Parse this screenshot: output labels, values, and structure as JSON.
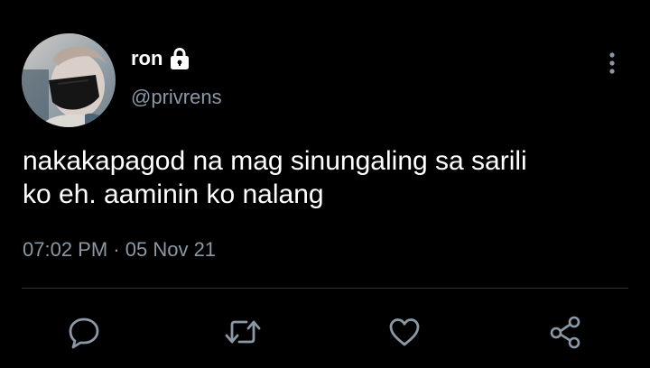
{
  "user": {
    "display_name": "ron",
    "handle": "@privrens",
    "protected_icon": "lock-icon",
    "avatar_icon": "profile-photo"
  },
  "tweet": {
    "text_line_1": "nakakapagod na mag sinungaling sa sarili",
    "text_line_2": "ko eh. aaminin ko nalang",
    "time": "07:02 PM",
    "separator": "·",
    "date": "05 Nov 21"
  },
  "actions": [
    {
      "name": "reply",
      "icon": "comment-bubble-icon"
    },
    {
      "name": "retweet",
      "icon": "retweet-arrows-icon"
    },
    {
      "name": "like",
      "icon": "heart-icon"
    },
    {
      "name": "share",
      "icon": "share-nodes-icon"
    }
  ],
  "menu": {
    "icon": "more-vertical-icon"
  },
  "colors": {
    "background": "#000000",
    "primary_text": "#ffffff",
    "secondary_text": "#8b98a5",
    "divider": "#2f3336"
  }
}
